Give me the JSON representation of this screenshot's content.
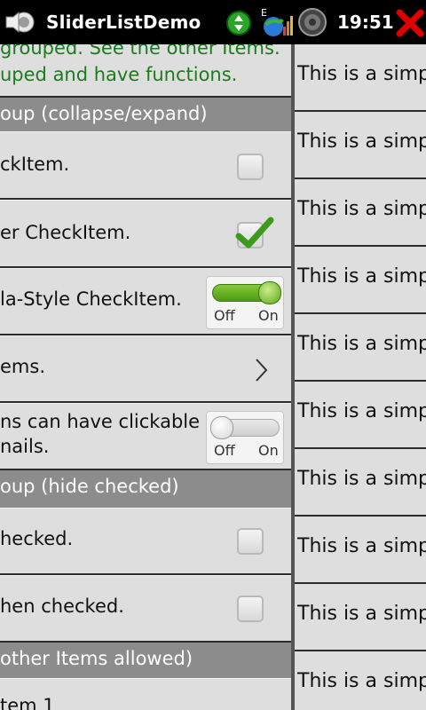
{
  "statusbar": {
    "app_title": "SliderListDemo",
    "clock": "19:51",
    "icons": [
      "app-icon",
      "network-icon",
      "signal-icon",
      "volume-icon",
      "close-icon"
    ],
    "close_color": "#e00000",
    "network_color": "#2aa52a"
  },
  "left_list": {
    "intro_lines": [
      "grouped. See the other Items.",
      "uped and have functions."
    ],
    "group1_header": "oup (collapse/expand)",
    "check_item": "ckItem.",
    "other_check_item": "er CheckItem.",
    "iphone_style_item": "la-Style CheckItem.",
    "toggle1": {
      "off": "Off",
      "on": "On",
      "state": "on"
    },
    "items_link": "ems.",
    "clickable_line1": "ns can have clickable",
    "clickable_line2": "nails.",
    "toggle2": {
      "off": "Off",
      "on": "On",
      "state": "off"
    },
    "group2_header": "oup (hide checked)",
    "hide_checked_item": "hecked.",
    "when_checked_item": "hen checked.",
    "group3_header": "other Items allowed)",
    "item1": "tem 1"
  },
  "right_list": {
    "rows": [
      "This is a simple",
      "This is a simple",
      "This is a simple",
      "This is a simple",
      "This is a simple",
      "This is a simple",
      "This is a simple",
      "This is a simple",
      "This is a simple",
      "This is a simple"
    ]
  },
  "colors": {
    "intro_text": "#1e7a1e",
    "header_bg": "#8c8c8c",
    "toggle_on": "#6fb12a"
  }
}
